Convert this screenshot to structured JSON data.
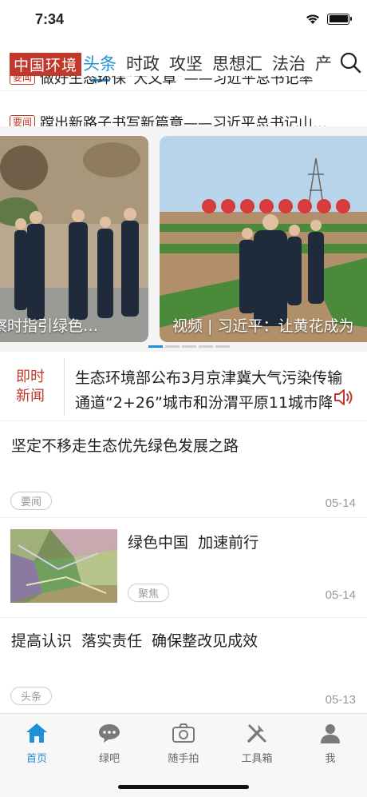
{
  "status": {
    "time": "7:34"
  },
  "nav": {
    "brand": "中国环境",
    "tabs": [
      "头条",
      "时政",
      "攻坚",
      "思想汇",
      "法治",
      "产"
    ],
    "active_tab": 0
  },
  "top_rows": [
    {
      "tag": "要闻",
      "text": "做好生态环保“大文章”——习近平总书记率"
    },
    {
      "tag": "要闻",
      "text": "蹚出新路子书写新篇章——习近平总书记山…"
    }
  ],
  "carousel": {
    "slides": [
      {
        "caption": "察时指引绿色…"
      },
      {
        "caption": "视频 | 习近平：让黄花成为"
      }
    ],
    "dots": 5,
    "active_dot": 0
  },
  "breaking": {
    "label_line1": "即时",
    "label_line2": "新闻",
    "text": "生态环境部公布3月京津冀大气污染传输通道“2+26”城市和汾渭平原11城市降"
  },
  "articles": [
    {
      "title": "坚定不移走生态优先绿色发展之路",
      "tag": "要闻",
      "date": "05-14"
    },
    {
      "title": "绿色中国  加速前行",
      "tag": "聚焦",
      "date": "05-14"
    },
    {
      "title": "提高认识  落实责任  确保整改见成效",
      "tag": "头条",
      "date": "05-13"
    }
  ],
  "tabbar": {
    "items": [
      {
        "label": "首页",
        "icon": "home-icon"
      },
      {
        "label": "绿吧",
        "icon": "chat-bubble-icon"
      },
      {
        "label": "随手拍",
        "icon": "camera-icon"
      },
      {
        "label": "工具箱",
        "icon": "tools-icon"
      },
      {
        "label": "我",
        "icon": "person-icon"
      }
    ],
    "active": 0
  },
  "colors": {
    "brand_red": "#c0392b",
    "accent_blue": "#1e90d6"
  }
}
